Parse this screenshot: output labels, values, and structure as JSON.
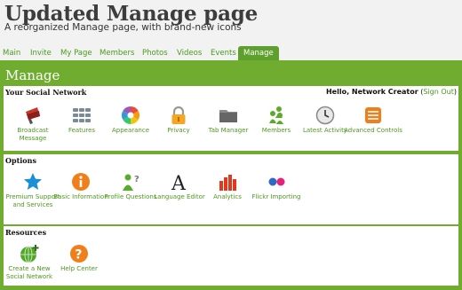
{
  "header": {
    "title": "Updated Manage page",
    "tagline": "A reorganized Manage page, with brand-new icons"
  },
  "nav": {
    "tabs": [
      "Main",
      "Invite",
      "My Page",
      "Members",
      "Photos",
      "Videos",
      "Events",
      "Manage"
    ],
    "active": "Manage"
  },
  "page": {
    "title": "Manage"
  },
  "sections": {
    "social": {
      "title": "Your Social Network",
      "greeting": {
        "hello": "Hello, Network Creator",
        "open": "(",
        "signout": "Sign Out",
        "close": ")"
      },
      "items": [
        {
          "label": "Broadcast Message",
          "icon": "megaphone-icon"
        },
        {
          "label": "Features",
          "icon": "grid-icon"
        },
        {
          "label": "Appearance",
          "icon": "color-wheel-icon"
        },
        {
          "label": "Privacy",
          "icon": "lock-icon"
        },
        {
          "label": "Tab Manager",
          "icon": "folder-icon"
        },
        {
          "label": "Members",
          "icon": "people-icon"
        },
        {
          "label": "Latest Activity",
          "icon": "clock-icon"
        },
        {
          "label": "Advanced Controls",
          "icon": "sliders-icon"
        }
      ]
    },
    "options": {
      "title": "Options",
      "items": [
        {
          "label": "Premium Support and Services",
          "icon": "star-icon"
        },
        {
          "label": "Basic Information",
          "icon": "info-icon"
        },
        {
          "label": "Profile Questions",
          "icon": "profile-question-icon"
        },
        {
          "label": "Language Editor",
          "icon": "letter-a-icon"
        },
        {
          "label": "Analytics",
          "icon": "bar-chart-icon"
        },
        {
          "label": "Flickr Importing",
          "icon": "flickr-icon"
        }
      ]
    },
    "resources": {
      "title": "Resources",
      "items": [
        {
          "label": "Create a New Social Network",
          "icon": "globe-plus-icon"
        },
        {
          "label": "Help Center",
          "icon": "help-icon"
        }
      ]
    }
  },
  "colors": {
    "accent": "#6fac2f",
    "link": "#4b9a1e",
    "background": "#f2f2f2"
  }
}
